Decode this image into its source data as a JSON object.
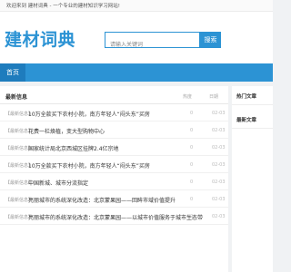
{
  "topbar": {
    "welcome": "欢迎来到 建材词典 - 一个专业的建材知识学习网站!"
  },
  "header": {
    "logo": "建材词典",
    "search_placeholder": "请输入关键词",
    "search_button": "搜索"
  },
  "nav": {
    "home_label": "首页"
  },
  "main": {
    "title": "最新信息",
    "col_hot": "热度",
    "col_date": "日期",
    "rows": [
      {
        "tag": "【最新信息】",
        "title": "10万全款买下农村小院，南方年轻人“闷头东”买房",
        "hot": "0",
        "date": "02-03"
      },
      {
        "tag": "【最新信息】",
        "title": "花费一栏焕植，变大型购物中心",
        "hot": "0",
        "date": "02-03"
      },
      {
        "tag": "【最新信息】",
        "title": "国家统计局北京西城区挂牌2.4亿宗地",
        "hot": "0",
        "date": "02-03"
      },
      {
        "tag": "【最新信息】",
        "title": "10万全款买下农村小院，南方年轻人“闷头东”买房",
        "hot": "0",
        "date": "02-03"
      },
      {
        "tag": "【最新信息】",
        "title": "中国新城、城市分流指定",
        "hot": "0",
        "date": "02-03"
      },
      {
        "tag": "【最新信息】",
        "title": "亮丽城市的系统深化改造：北京蒙果园——回眸市域价值提升",
        "hot": "0",
        "date": "02-03"
      },
      {
        "tag": "【最新信息】",
        "title": "亮丽城市的系统深化改造：北京蒙果园——以城市价值服务于城市生态带",
        "hot": "0",
        "date": "02-03"
      }
    ]
  },
  "sidebar": {
    "hot_title": "热门文章",
    "latest_title": "最新文章"
  },
  "colors": {
    "brand": "#2c93d4",
    "nav_active": "#1e7cbd"
  }
}
